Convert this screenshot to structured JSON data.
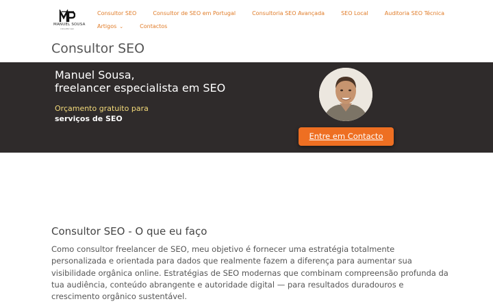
{
  "brand": {
    "logo_name": "MANUEL SOUSA",
    "logo_sub": "consultor seo",
    "accent_color": "#e07b27"
  },
  "nav": {
    "row1": [
      {
        "label": "Consultor SEO"
      },
      {
        "label": "Consultor de SEO em Portugal"
      },
      {
        "label": "Consultoria SEO Avançada"
      },
      {
        "label": "SEO Local"
      },
      {
        "label": "Auditoria SEO Técnica"
      }
    ],
    "row2": [
      {
        "label": "Artigos",
        "has_dropdown": true
      },
      {
        "label": "Contactos"
      }
    ]
  },
  "page": {
    "title": "Consultor SEO"
  },
  "hero": {
    "name_line1": "Manuel Sousa,",
    "name_line2": "freelancer especialista em SEO",
    "offer_line1": "Orçamento gratuito para",
    "offer_line2": "serviços de SEO",
    "cta_label": "Entre em Contacto",
    "cta_color": "#ee6f22",
    "background": "#2f2b2b"
  },
  "content": {
    "section_title": "Consultor SEO - O que eu faço",
    "paragraph": "Como consultor freelancer de SEO, meu objetivo é fornecer uma estratégia totalmente personalizada e orientada para dados que realmente fazem a diferença para aumentar sua visibilidade orgânica online. Estratégias de SEO modernas que combinam compreensão profunda da tua audiência, conteúdo abrangente e autoridade digital — para resultados duradouros e crescimento orgânico sustentável."
  }
}
